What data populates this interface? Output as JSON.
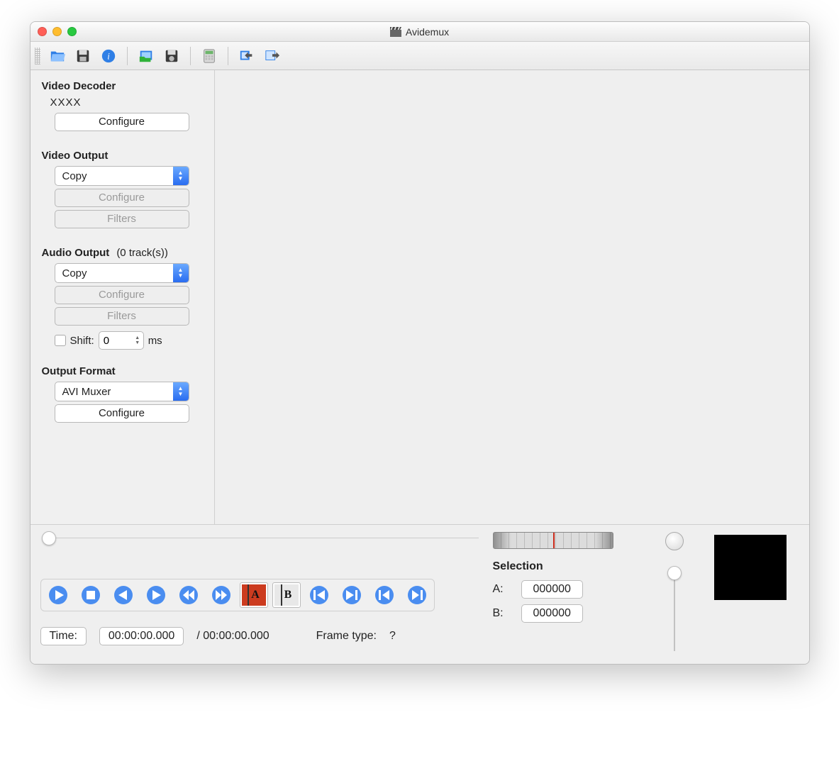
{
  "window": {
    "title": "Avidemux"
  },
  "sidebar": {
    "video_decoder": {
      "heading": "Video Decoder",
      "value": "XXXX",
      "configure": "Configure"
    },
    "video_output": {
      "heading": "Video Output",
      "selected": "Copy",
      "configure": "Configure",
      "filters": "Filters"
    },
    "audio_output": {
      "heading": "Audio Output",
      "tracks_suffix": "(0 track(s))",
      "selected": "Copy",
      "configure": "Configure",
      "filters": "Filters",
      "shift_label": "Shift:",
      "shift_value": "0",
      "shift_unit": "ms"
    },
    "output_format": {
      "heading": "Output Format",
      "selected": "AVI Muxer",
      "configure": "Configure"
    }
  },
  "timebar": {
    "time_label": "Time:",
    "time_value": "00:00:00.000",
    "duration": "/ 00:00:00.000",
    "frametype_label": "Frame type:",
    "frametype_value": "?"
  },
  "selection": {
    "heading": "Selection",
    "a_label": "A:",
    "a_value": "000000",
    "b_label": "B:",
    "b_value": "000000"
  }
}
